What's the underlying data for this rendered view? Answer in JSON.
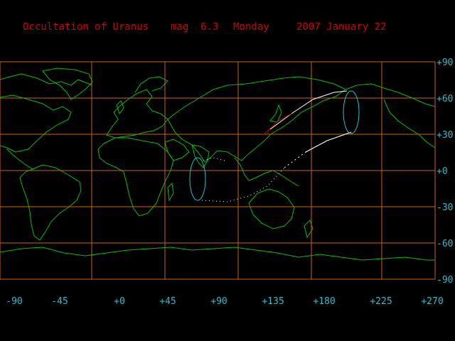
{
  "header": {
    "title": "Occultation of Uranus",
    "magnitude": "mag  6.3",
    "weekday": "Monday",
    "date": "2007 January 22"
  },
  "grid": {
    "lon_labels": [
      "-90",
      "-45",
      "+0",
      "+45",
      "+90",
      "+135",
      "+180",
      "+225",
      "+270"
    ],
    "lat_labels": [
      "+90",
      "+60",
      "+30",
      "+0",
      "-30",
      "-60",
      "-90"
    ]
  },
  "colors": {
    "background": "#000000",
    "title": "#d00000",
    "grid": "#c8641e",
    "coast": "#00c000",
    "labels": "#22c0d0",
    "path": "#ffffff",
    "path_alt": "#c00000"
  }
}
